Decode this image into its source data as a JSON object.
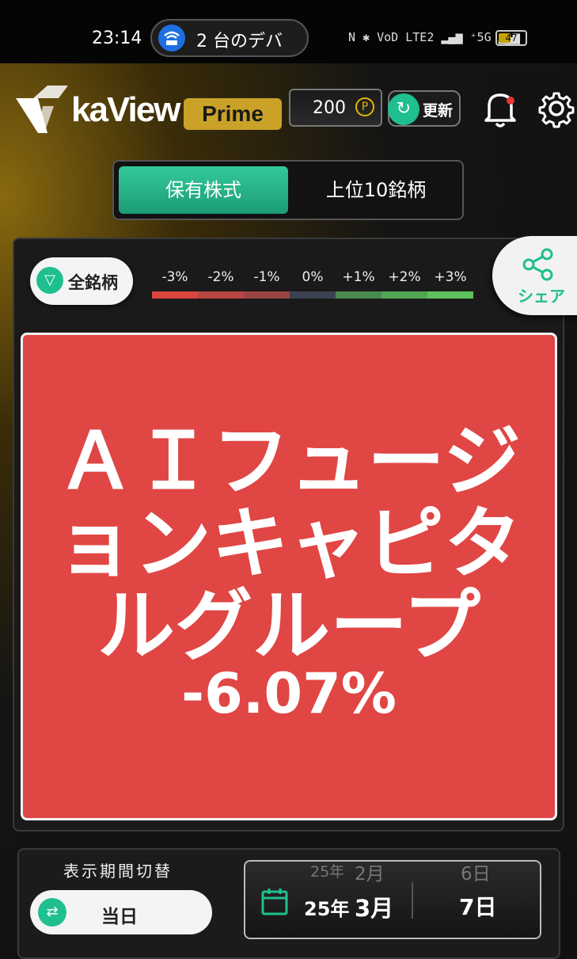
{
  "status_bar": {
    "time": "23:14",
    "connection_text": "2 台のデバ",
    "icons_text": "N  ✱  VoD LTE2  ▂▄▆  ⁺5G ▂▄▆",
    "battery": "47",
    "battery_level": 0.47
  },
  "header": {
    "logo_text": "kaView",
    "prime_label": "Prime",
    "points_value": "200",
    "points_symbol": "P",
    "refresh_label": "更新",
    "refresh_icon": "↻"
  },
  "tabs": {
    "holdings": "保有株式",
    "top10": "上位10銘柄"
  },
  "filter": {
    "label": "全銘柄",
    "icon": "▽"
  },
  "legend": {
    "labels": [
      "-3%",
      "-2%",
      "-1%",
      "0%",
      "+1%",
      "+2%",
      "+3%"
    ],
    "colors": [
      "#d9463f",
      "#b84642",
      "#9a4543",
      "#3d4252",
      "#4a8a4e",
      "#50a653",
      "#5dc25e"
    ]
  },
  "share": {
    "label": "シェア"
  },
  "tile": {
    "name": "ＡＩフュージョンキャピタルグループ",
    "change": "-6.07%",
    "color": "#e04644"
  },
  "period": {
    "label": "表示期間切替",
    "button": "当日",
    "icon": "⇄"
  },
  "date": {
    "prev_year": "25年",
    "prev_month": "2月",
    "year": "25年",
    "month": "3月",
    "prev_day": "6日",
    "day": "7日"
  },
  "colors": {
    "accent": "#1fbf8f",
    "gold": "#c9a227"
  }
}
